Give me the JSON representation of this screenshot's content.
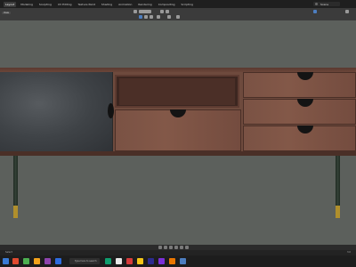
{
  "menubar": {
    "items": [
      "Layout",
      "Modeling",
      "Sculpting",
      "UV Editing",
      "Texture Paint",
      "Shading",
      "Animation",
      "Rendering",
      "Compositing",
      "Scripting"
    ],
    "scene_label": "Scene"
  },
  "viewport": {
    "view_label": "View"
  },
  "status": {
    "left": "Select",
    "right": "3.0"
  },
  "taskbar": {
    "search_placeholder": "Type here to search"
  },
  "colors": {
    "wood": "#7a5244",
    "door": "#3f4347",
    "leg": "#2a352c",
    "brass": "#b08f2c",
    "accent": "#4d7ec0"
  }
}
